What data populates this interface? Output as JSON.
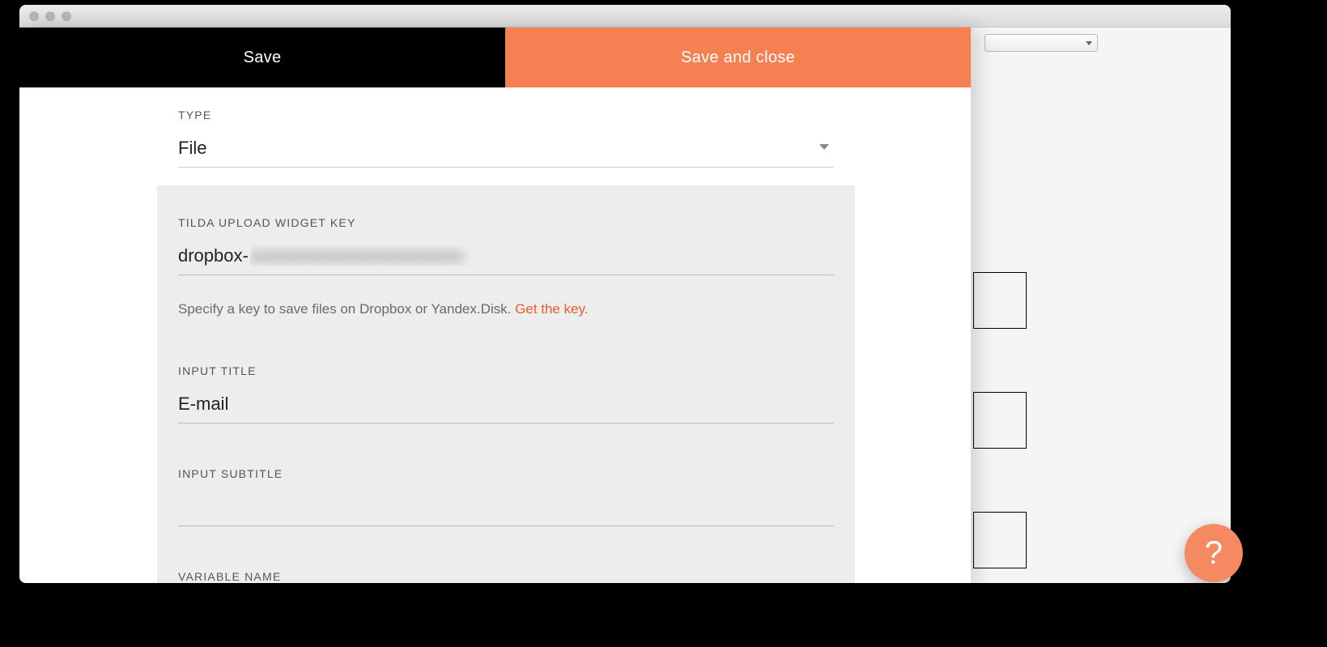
{
  "modal": {
    "tabs": {
      "save": "Save",
      "save_and_close": "Save and close"
    },
    "fields": {
      "type": {
        "label": "TYPE",
        "value": "File"
      },
      "upload_key": {
        "label": "TILDA UPLOAD WIDGET KEY",
        "prefix": "dropbox-",
        "value_masked": "xxxxxxxxxxxxxxxxxxxxxxxx",
        "helper_text": "Specify a key to save files on Dropbox or Yandex.Disk. ",
        "helper_link": "Get the key."
      },
      "input_title": {
        "label": "INPUT TITLE",
        "value": "E-mail"
      },
      "input_subtitle": {
        "label": "INPUT SUBTITLE",
        "value": ""
      },
      "variable_name": {
        "label": "VARIABLE NAME",
        "value": ""
      }
    }
  },
  "help_fab": "?"
}
